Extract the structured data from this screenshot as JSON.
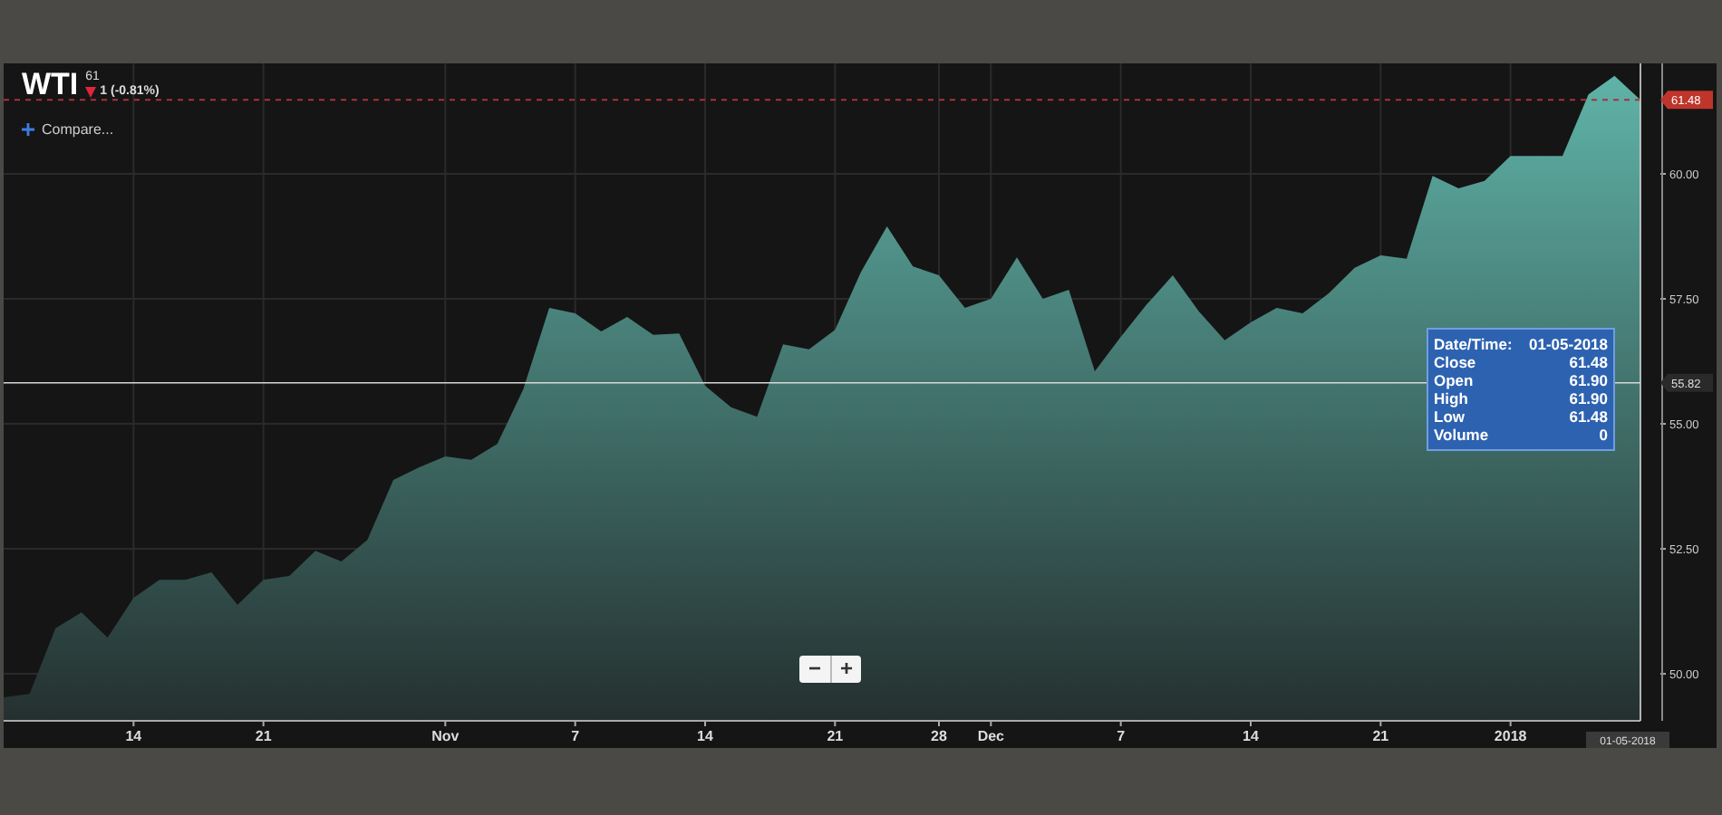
{
  "header": {
    "symbol": "WTI",
    "price": "61",
    "change": "1 (-0.81%)"
  },
  "crosshair": {
    "date": "01-05-2018"
  },
  "compare_button": {
    "label": "Compare..."
  },
  "zoom_buttons": [
    {
      "label": "−"
    },
    {
      "label": "+"
    }
  ],
  "tooltip": [
    {
      "label": "Date/Time:",
      "value": "01-05-2018"
    },
    {
      "label": "Close",
      "value": "61.48"
    },
    {
      "label": "Open",
      "value": "61.90"
    },
    {
      "label": "High",
      "value": "61.90"
    },
    {
      "label": "Low",
      "value": "61.48"
    },
    {
      "label": "Volume",
      "value": "0"
    }
  ],
  "chart_data": {
    "type": "area",
    "categories": [
      null,
      null,
      null,
      null,
      null,
      "14",
      null,
      null,
      null,
      null,
      "21",
      null,
      null,
      null,
      null,
      null,
      null,
      "Nov",
      null,
      null,
      null,
      null,
      "7",
      null,
      null,
      null,
      null,
      "14",
      null,
      null,
      null,
      null,
      "21",
      null,
      null,
      null,
      "28",
      null,
      "Dec",
      null,
      null,
      null,
      null,
      "7",
      null,
      null,
      null,
      null,
      "14",
      null,
      null,
      null,
      null,
      "21",
      null,
      null,
      null,
      null,
      "2018",
      null,
      null,
      null,
      null,
      null
    ],
    "series": [
      {
        "color": "#5fb3a8",
        "values": [
          49.53,
          49.6,
          50.91,
          51.23,
          50.72,
          51.52,
          51.88,
          51.88,
          52.03,
          51.38,
          51.88,
          51.96,
          52.46,
          52.25,
          52.68,
          53.88,
          54.13,
          54.35,
          54.28,
          54.6,
          55.69,
          57.32,
          57.21,
          56.85,
          57.14,
          56.78,
          56.81,
          55.76,
          55.33,
          55.14,
          56.59,
          56.49,
          56.88,
          58.04,
          58.95,
          58.15,
          57.97,
          57.32,
          57.5,
          58.33,
          57.5,
          57.68,
          56.05,
          56.74,
          57.39,
          57.97,
          57.25,
          56.67,
          57.03,
          57.32,
          57.21,
          57.61,
          58.12,
          58.37,
          58.3,
          59.96,
          59.71,
          59.86,
          60.36,
          60.36,
          60.36,
          61.59,
          61.96,
          61.48
        ]
      }
    ],
    "ylim": [
      49.06,
      62.21
    ],
    "grid": true,
    "ref_lines": [
      {
        "axis": "y",
        "value": 61.48,
        "label": "61.48",
        "color": "#a8323a"
      },
      {
        "axis": "y",
        "value": 55.82,
        "label": "55.82",
        "color": "#d8d8d8"
      }
    ],
    "yticks": [
      {
        "value": 50,
        "label": "50.00"
      },
      {
        "value": 52.5,
        "label": "52.50"
      },
      {
        "value": 55,
        "label": "55.00"
      },
      {
        "value": 57.5,
        "label": "57.50"
      },
      {
        "value": 60,
        "label": "60.00"
      }
    ]
  }
}
